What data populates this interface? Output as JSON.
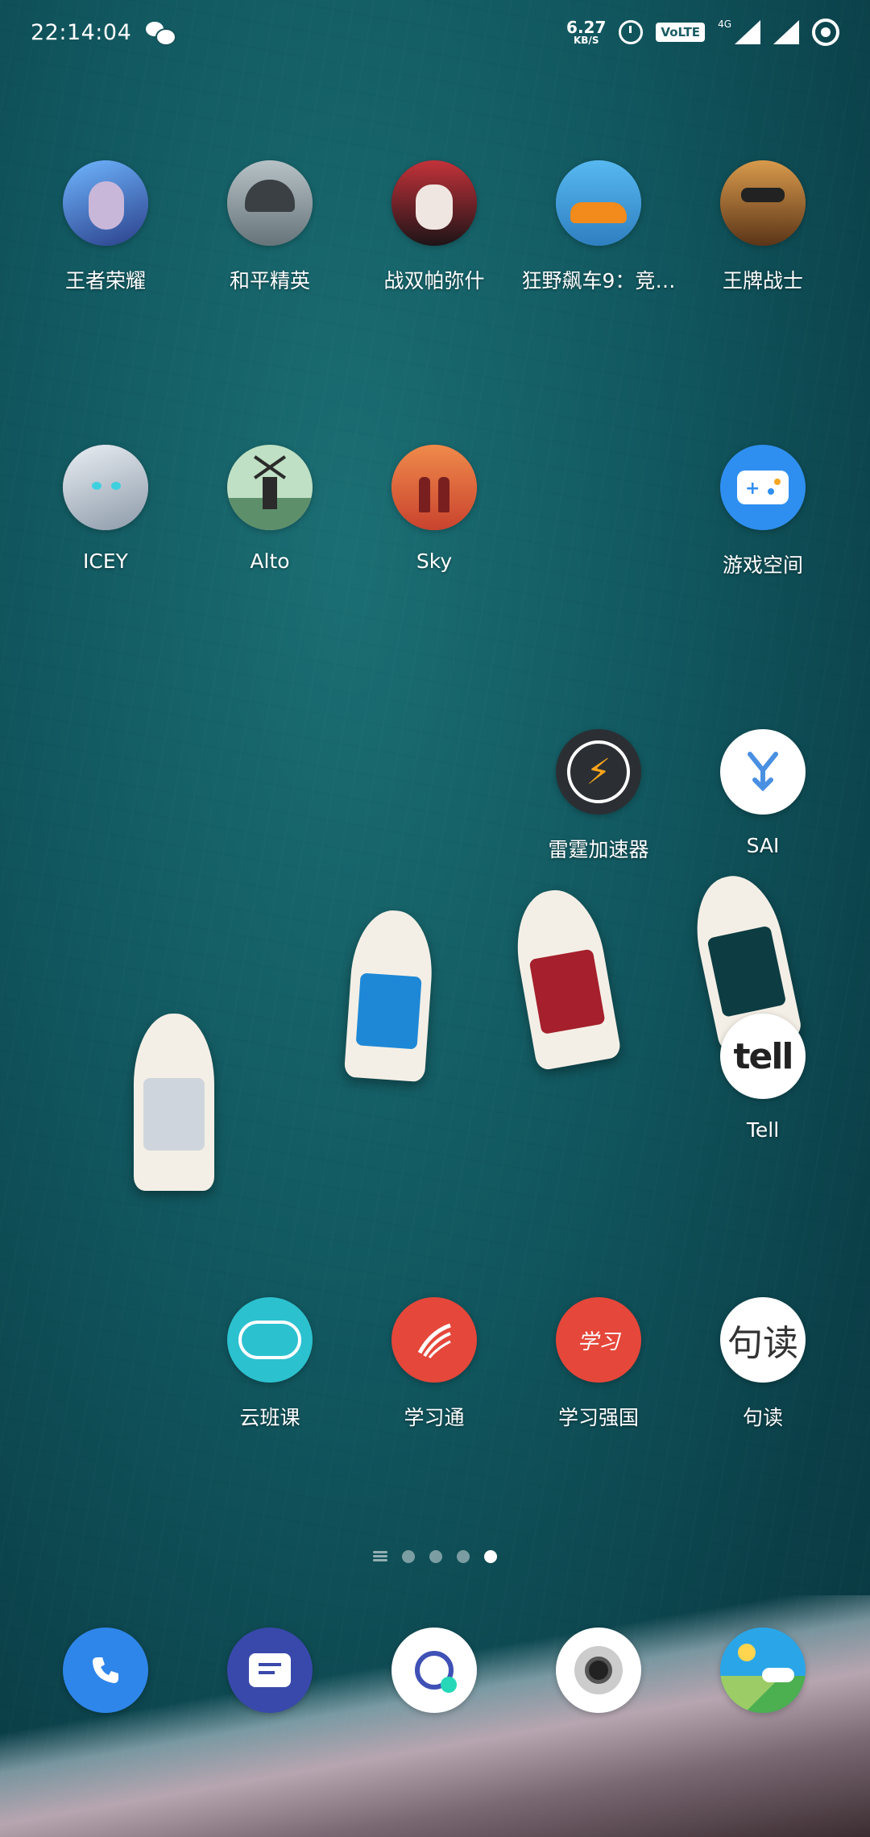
{
  "status_bar": {
    "time": "22:14:04",
    "net_speed_value": "6.27",
    "net_speed_unit": "KB/S",
    "volte": "VoLTE",
    "network": "4G",
    "notification_icon": "wechat-icon",
    "icons": [
      "alarm-icon",
      "signal-icon",
      "battery-icon"
    ]
  },
  "home_apps": [
    {
      "label": "王者荣耀",
      "icon": "honor-of-kings-icon",
      "color": "#3b5fb0"
    },
    {
      "label": "和平精英",
      "icon": "peacekeeper-elite-icon",
      "color": "#7d8a8f"
    },
    {
      "label": "战双帕弥什",
      "icon": "punishing-gray-raven-icon",
      "color": "#2a1a20"
    },
    {
      "label": "狂野飙车9：竞…",
      "icon": "asphalt-9-icon",
      "color": "#3fa3e0"
    },
    {
      "label": "王牌战士",
      "icon": "ace-warrior-icon",
      "color": "#7a4a28"
    },
    {
      "label": "ICEY",
      "icon": "icey-icon",
      "color": "#9aa8b8"
    },
    {
      "label": "Alto",
      "icon": "alto-icon",
      "color": "#bfe0c4"
    },
    {
      "label": "Sky",
      "icon": "sky-icon",
      "color": "#e8683a"
    },
    {
      "label": "游戏空间",
      "icon": "game-space-icon",
      "color": "#2f8ff0"
    },
    {
      "label": "雷霆加速器",
      "icon": "thunder-accelerator-icon",
      "color": "#2b2f33"
    },
    {
      "label": "SAI",
      "icon": "sai-icon",
      "color": "#ffffff"
    },
    {
      "label": "Tell",
      "icon": "tell-icon",
      "color": "#ffffff",
      "text": "tell"
    },
    {
      "label": "云班课",
      "icon": "cloud-class-icon",
      "color": "#2cc1cf"
    },
    {
      "label": "学习通",
      "icon": "xuexitong-icon",
      "color": "#e5473a"
    },
    {
      "label": "学习强国",
      "icon": "xuexi-qiangguo-icon",
      "color": "#e5473a",
      "text": "学习"
    },
    {
      "label": "句读",
      "icon": "judu-icon",
      "color": "#ffffff",
      "text": "句读"
    }
  ],
  "page_indicator": {
    "pages": 4,
    "active": 4
  },
  "dock": [
    {
      "icon": "phone-icon",
      "color": "#2f86ea"
    },
    {
      "icon": "messages-icon",
      "color": "#3949ab"
    },
    {
      "icon": "browser-icon",
      "color": "#ffffff"
    },
    {
      "icon": "camera-icon",
      "color": "#ffffff"
    },
    {
      "icon": "gallery-icon",
      "color": "#2aa6e8"
    }
  ],
  "colors": {
    "wallpaper": "#11565e",
    "label_text": "#ffffff"
  }
}
